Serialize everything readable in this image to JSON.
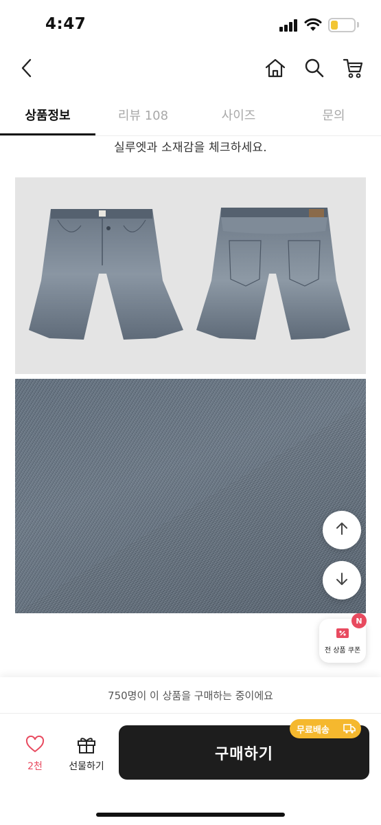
{
  "status_bar": {
    "time": "4:47",
    "battery_level": 0.3,
    "battery_color": "#f2c533"
  },
  "header": {
    "back_icon": "chevron-left-icon",
    "home_icon": "home-icon",
    "search_icon": "search-icon",
    "cart_icon": "cart-icon"
  },
  "tabs": [
    {
      "label": "상품정보",
      "active": true
    },
    {
      "label": "리뷰 108",
      "active": false
    },
    {
      "label": "사이즈",
      "active": false
    },
    {
      "label": "문의",
      "active": false
    }
  ],
  "content": {
    "caption": "실루엣과 소재감을 체크하세요."
  },
  "floating": {
    "scroll_up_icon": "arrow-up-icon",
    "scroll_down_icon": "arrow-down-icon",
    "coupon_label": "전 상품 쿠폰",
    "coupon_badge": "N"
  },
  "bottom_bar": {
    "purchase_note": "750명이 이 상품을 구매하는 중이에요",
    "like_count": "2천",
    "gift_label": "선물하기",
    "buy_label": "구매하기",
    "free_shipping": "무료배송"
  },
  "colors": {
    "accent": "#e84a5f",
    "free_shipping": "#f5b82e",
    "buy_button": "#1d1d1d"
  }
}
